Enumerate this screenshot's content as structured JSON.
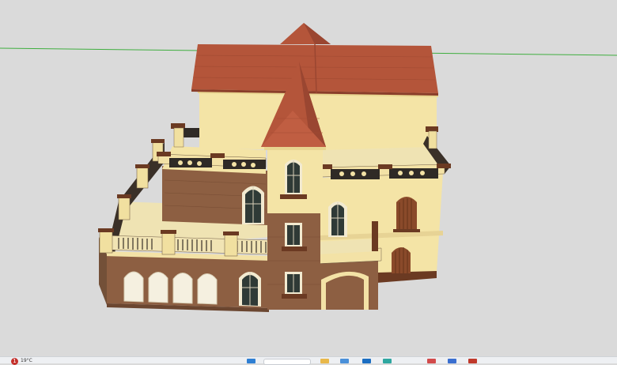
{
  "viewport": {
    "background": "#dadada",
    "axis_green": "#3fae3f"
  },
  "model": {
    "roof_color": "#b4553a",
    "wall_color": "#f4e4a6",
    "stone_color": "#8a5a3c",
    "trim_color": "#6b3a22",
    "window_color": "#3b4a44"
  },
  "taskbar": {
    "notification_count": "1",
    "status_text": "19°C",
    "icons": [
      {
        "name": "edge-icon",
        "color": "#2f7fd3"
      },
      {
        "name": "explorer-icon",
        "color": "#e8b84a"
      },
      {
        "name": "store-icon",
        "color": "#4a90d9"
      },
      {
        "name": "mail-icon",
        "color": "#1b6ec2"
      },
      {
        "name": "photos-icon",
        "color": "#2fa7a0"
      },
      {
        "name": "app-red-icon",
        "color": "#d24b4b"
      },
      {
        "name": "app-blue-icon",
        "color": "#3a6fd0"
      },
      {
        "name": "sketchup-icon",
        "color": "#c0392b"
      }
    ]
  }
}
